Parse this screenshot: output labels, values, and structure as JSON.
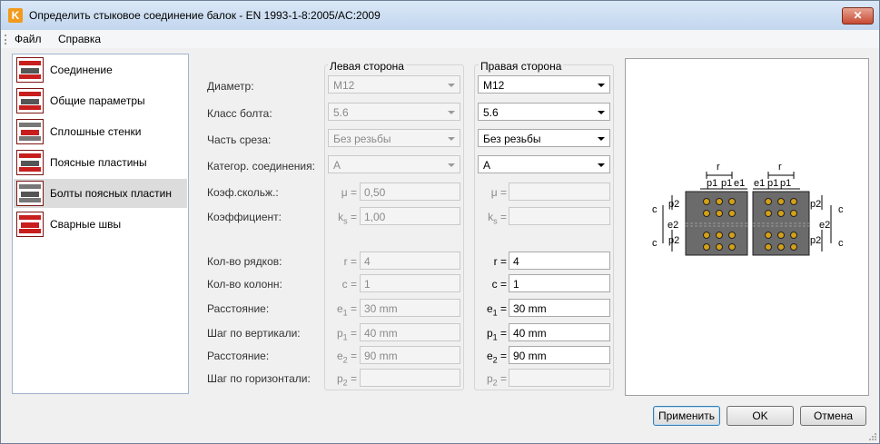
{
  "window": {
    "title": "Определить стыковое соединение балок - EN 1993-1-8:2005/AC:2009",
    "app_icon": "K",
    "close_label": "✕"
  },
  "menu": [
    "Файл",
    "Справка"
  ],
  "sidebar": {
    "items": [
      {
        "label": "Соединение",
        "icon": "connection-icon"
      },
      {
        "label": "Общие параметры",
        "icon": "general-params-icon"
      },
      {
        "label": "Сплошные стенки",
        "icon": "web-plates-icon"
      },
      {
        "label": "Поясные пластины",
        "icon": "flange-plates-icon"
      },
      {
        "label": "Болты поясных пластин",
        "icon": "flange-bolts-icon",
        "selected": true
      },
      {
        "label": "Сварные швы",
        "icon": "welds-icon"
      }
    ]
  },
  "groups": {
    "left": "Левая сторона",
    "right": "Правая сторона"
  },
  "labels": {
    "diameter": "Диаметр:",
    "bolt_class": "Класс болта:",
    "shear_part": "Часть среза:",
    "connection_category": "Категор. соединения:",
    "friction_coef": "Коэф.скольж.:",
    "coefficient": "Коэффициент:",
    "rows": "Кол-во рядков:",
    "cols": "Кол-во колонн:",
    "distance_e1": "Расстояние:",
    "pitch_vertical": "Шаг по вертикали:",
    "distance_e2": "Расстояние:",
    "pitch_horizontal": "Шаг по горизонтали:"
  },
  "symbols": {
    "mu": "μ =",
    "ks": "k",
    "ks_sub": "s",
    "r": "r =",
    "c": "c =",
    "e": "e",
    "p": "p",
    "one": "1",
    "two": "2",
    "eq": " ="
  },
  "left": {
    "diameter": "M12",
    "bolt_class": "5.6",
    "shear_part": "Без резьбы",
    "category": "A",
    "mu": "0,50",
    "ks": "1,00",
    "r": "4",
    "c": "1",
    "e1": "30 mm",
    "p1": "40 mm",
    "e2": "90 mm",
    "p2": ""
  },
  "right": {
    "diameter": "M12",
    "bolt_class": "5.6",
    "shear_part": "Без резьбы",
    "category": "A",
    "mu": "",
    "ks": "",
    "r": "4",
    "c": "1",
    "e1": "30 mm",
    "p1": "40 mm",
    "e2": "90 mm",
    "p2": ""
  },
  "diagram": {
    "r": "r",
    "p1": "p1",
    "e1": "e1",
    "p2": "p2",
    "c": "c",
    "e2": "e2"
  },
  "buttons": {
    "apply": "Применить",
    "ok": "OK",
    "cancel": "Отмена"
  },
  "colors": {
    "accent": "#c81e1e",
    "bolt": "#d4a017",
    "plate": "#6b6b6b"
  }
}
